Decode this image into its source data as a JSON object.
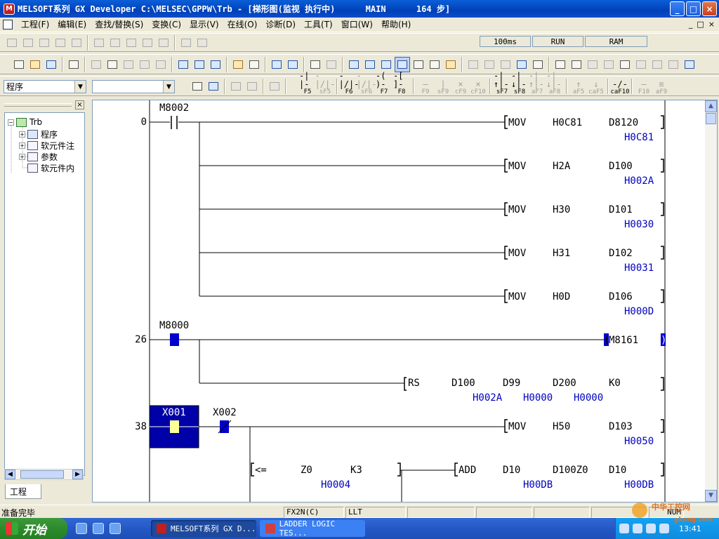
{
  "window": {
    "title": "MELSOFT系列 GX Developer C:\\MELSEC\\GPPW\\Trb - [梯形图(监视 执行中)      MAIN      164 步]",
    "btn_min": "_",
    "btn_max": "□",
    "btn_close": "×"
  },
  "menu": [
    "工程(F)",
    "编辑(E)",
    "查找/替换(S)",
    "变换(C)",
    "显示(V)",
    "在线(O)",
    "诊断(D)",
    "工具(T)",
    "窗口(W)",
    "帮助(H)"
  ],
  "toolbar_status": {
    "scan_time": "100ms",
    "cpu_state": "RUN",
    "memory": "RAM"
  },
  "combos": {
    "program_select": "程序",
    "second_select": ""
  },
  "function_keys": [
    {
      "sym": "-| |-",
      "label": "F5",
      "enabled": true
    },
    {
      "sym": "-|/|-",
      "label": "sF5",
      "enabled": false
    },
    {
      "sym": "-|/|-",
      "label": "F6",
      "enabled": true
    },
    {
      "sym": "-|/|-",
      "label": "sF6",
      "enabled": false
    },
    {
      "sym": "-( )-",
      "label": "F7",
      "enabled": true
    },
    {
      "sym": "-[ ]-",
      "label": "F8",
      "enabled": true
    },
    {
      "sym": "—",
      "label": "F9",
      "enabled": false
    },
    {
      "sym": "|",
      "label": "sF9",
      "enabled": false
    },
    {
      "sym": "×",
      "label": "cF9",
      "enabled": false
    },
    {
      "sym": "×",
      "label": "cF10",
      "enabled": false
    },
    {
      "sym": "-|↑|-",
      "label": "sF7",
      "enabled": true
    },
    {
      "sym": "-|↓|-",
      "label": "sF8",
      "enabled": true
    },
    {
      "sym": "-|↑|-",
      "label": "aF7",
      "enabled": false
    },
    {
      "sym": "-|↓|-",
      "label": "aF8",
      "enabled": false
    },
    {
      "sym": "↑",
      "label": "aF5",
      "enabled": false
    },
    {
      "sym": "↓",
      "label": "caF5",
      "enabled": false
    },
    {
      "sym": "-/-",
      "label": "caF10",
      "enabled": true
    },
    {
      "sym": "—",
      "label": "F10",
      "enabled": false
    },
    {
      "sym": "≡",
      "label": "aF9",
      "enabled": false
    }
  ],
  "project_tree": {
    "root": "Trb",
    "children": [
      "程序",
      "软元件注",
      "参数",
      "软元件内"
    ],
    "tab": "工程"
  },
  "ladder": {
    "steps": [
      "0",
      "26",
      "38"
    ],
    "contacts": {
      "c1": "M8002",
      "c2": "M8000",
      "c3": "X001",
      "c4": "X002"
    },
    "instructions": [
      {
        "op": "MOV",
        "a": "H0C81",
        "b": "D8120",
        "val": "H0C81"
      },
      {
        "op": "MOV",
        "a": "H2A",
        "b": "D100",
        "val": "H002A"
      },
      {
        "op": "MOV",
        "a": "H30",
        "b": "D101",
        "val": "H0030"
      },
      {
        "op": "MOV",
        "a": "H31",
        "b": "D102",
        "val": "H0031"
      },
      {
        "op": "MOV",
        "a": "H0D",
        "b": "D106",
        "val": "H000D"
      }
    ],
    "coil": "M8161",
    "rs": {
      "op": "RS",
      "a": "D100",
      "b": "D99",
      "c": "D200",
      "d": "K0",
      "va": "H002A",
      "vb": "H0000",
      "vc": "H0000"
    },
    "mov50": {
      "op": "MOV",
      "a": "H50",
      "b": "D103",
      "val": "H0050"
    },
    "cmp": {
      "op": "<=",
      "a": "Z0",
      "b": "K3",
      "va": "H0004"
    },
    "add": {
      "op": "ADD",
      "a": "D10",
      "b": "D100Z0",
      "c": "D10",
      "va": "H00DB",
      "vc": "H00DB"
    }
  },
  "statusbar": {
    "ready": "准备完毕",
    "plc_type": "FX2N(C)",
    "mode": "LLT",
    "num": "NUM"
  },
  "taskbar": {
    "start": "开始",
    "tasks": [
      "MELSOFT系列 GX D...",
      "LADDER LOGIC TES..."
    ],
    "clock": "13:41"
  },
  "watermark": {
    "line1": "中华工控网",
    "line2": "gkong.com"
  },
  "colors": {
    "selection_blue": "#0000a8",
    "contact_on": "#0000cc",
    "value_blue": "#0000c0",
    "title_bar": "#0040b8"
  }
}
